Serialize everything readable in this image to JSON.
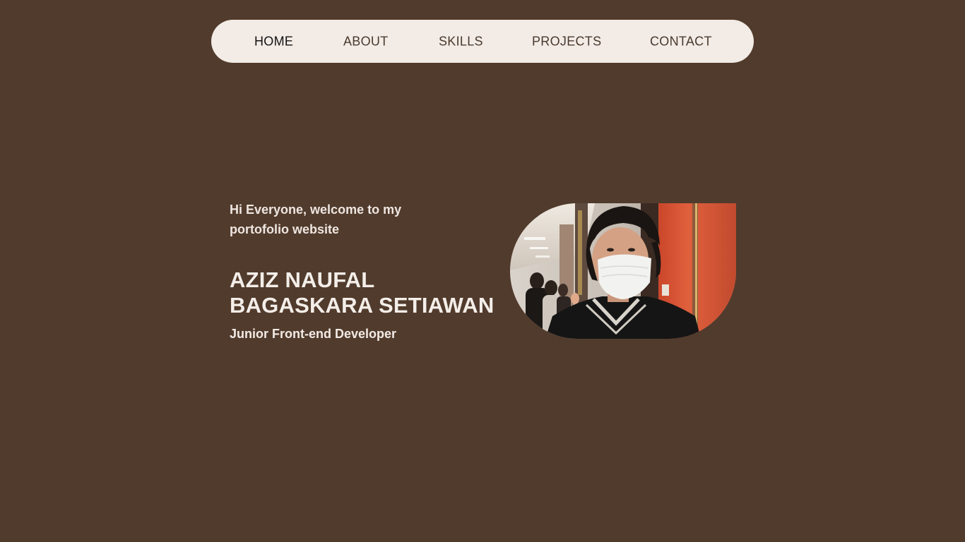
{
  "nav": {
    "items": [
      {
        "label": "HOME",
        "active": true
      },
      {
        "label": "ABOUT",
        "active": false
      },
      {
        "label": "SKILLS",
        "active": false
      },
      {
        "label": "PROJECTS",
        "active": false
      },
      {
        "label": "CONTACT",
        "active": false
      }
    ]
  },
  "hero": {
    "greeting": "Hi Everyone, welcome to my portofolio website",
    "name_line1": "AZIZ NAUFAL",
    "name_line2": "BAGASKARA SETIAWAN",
    "role": "Junior Front-end Developer"
  },
  "colors": {
    "background": "#513b2c",
    "nav_background": "#f2ebe6",
    "text_light": "#f2ebe6"
  }
}
